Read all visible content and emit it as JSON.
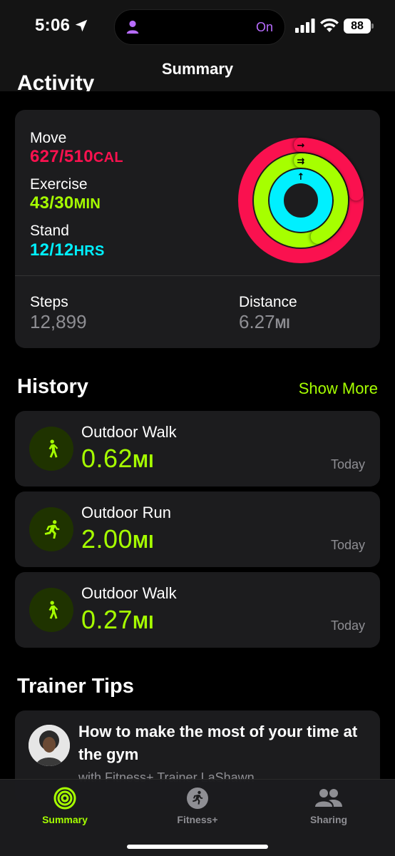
{
  "status_bar": {
    "time": "5:06",
    "island_status": "On",
    "battery": "88"
  },
  "nav": {
    "title": "Summary",
    "peek_section": "Activity"
  },
  "activity": {
    "move": {
      "label": "Move",
      "value": "627/510",
      "unit": "CAL",
      "progress": 1.23,
      "color": "#fa114f"
    },
    "exercise": {
      "label": "Exercise",
      "value": "43/30",
      "unit": "MIN",
      "progress": 1.43,
      "color": "#a6ff00"
    },
    "stand": {
      "label": "Stand",
      "value": "12/12",
      "unit": "HRS",
      "progress": 1.0,
      "color": "#00f0ff"
    },
    "steps": {
      "label": "Steps",
      "value": "12,899"
    },
    "distance": {
      "label": "Distance",
      "value": "6.27",
      "unit": "MI"
    }
  },
  "history": {
    "title": "History",
    "show_more": "Show More",
    "items": [
      {
        "title": "Outdoor Walk",
        "value": "0.62",
        "unit": "MI",
        "date": "Today",
        "icon": "walk-icon"
      },
      {
        "title": "Outdoor Run",
        "value": "2.00",
        "unit": "MI",
        "date": "Today",
        "icon": "run-icon"
      },
      {
        "title": "Outdoor Walk",
        "value": "0.27",
        "unit": "MI",
        "date": "Today",
        "icon": "walk-icon"
      }
    ]
  },
  "trainer_tips": {
    "title": "Trainer Tips",
    "headline": "How to make the most of your time at the gym",
    "subtitle": "with Fitness+ Trainer LaShawn"
  },
  "tabs": [
    {
      "label": "Summary",
      "icon": "activity-rings-icon",
      "active": true
    },
    {
      "label": "Fitness+",
      "icon": "fitness-plus-icon",
      "active": false
    },
    {
      "label": "Sharing",
      "icon": "people-icon",
      "active": false
    }
  ],
  "colors": {
    "accent": "#a6ff00",
    "move": "#fa114f",
    "stand": "#00f0ff",
    "card": "#1c1c1e",
    "secondary_text": "#8e8e93"
  }
}
